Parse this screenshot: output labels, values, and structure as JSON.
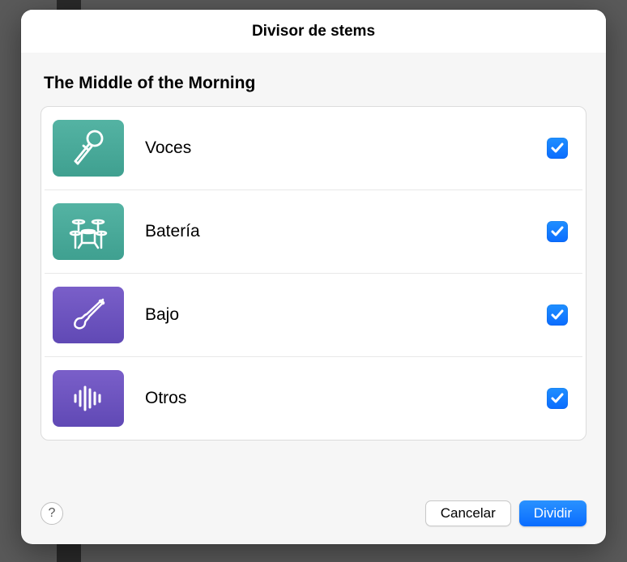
{
  "dialog": {
    "title": "Divisor de stems",
    "song_title": "The Middle of the Morning"
  },
  "stems": [
    {
      "label": "Voces",
      "checked": true,
      "icon": "microphone",
      "color": "teal"
    },
    {
      "label": "Batería",
      "checked": true,
      "icon": "drums",
      "color": "teal"
    },
    {
      "label": "Bajo",
      "checked": true,
      "icon": "bass",
      "color": "purple"
    },
    {
      "label": "Otros",
      "checked": true,
      "icon": "waveform",
      "color": "purple"
    }
  ],
  "footer": {
    "help": "?",
    "cancel": "Cancelar",
    "split": "Dividir"
  }
}
